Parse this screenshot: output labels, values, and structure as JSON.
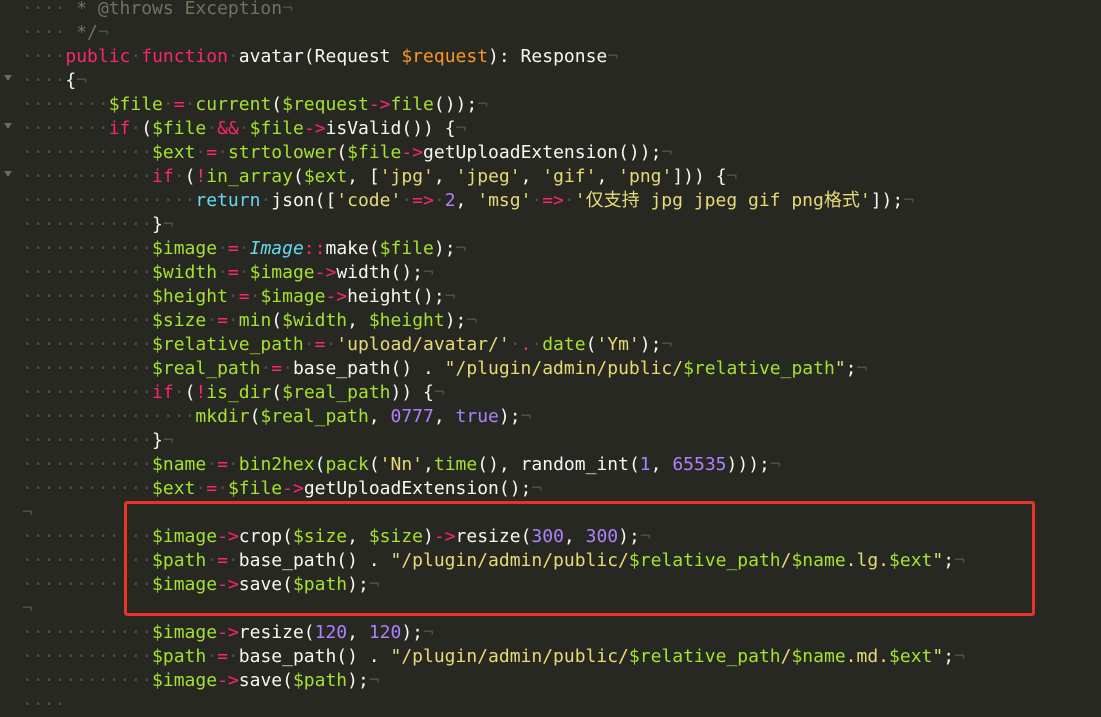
{
  "editor": {
    "lines": [
      [
        [
          "ws",
          "····"
        ],
        [
          "cm",
          " * @throws Exception"
        ],
        [
          "nl",
          "¬"
        ]
      ],
      [
        [
          "ws",
          "····"
        ],
        [
          "cm",
          " */"
        ],
        [
          "nl",
          "¬"
        ]
      ],
      [
        [
          "ws",
          "····"
        ],
        [
          "kw",
          "public"
        ],
        [
          "ws",
          "·"
        ],
        [
          "kw",
          "function"
        ],
        [
          "ws",
          "·"
        ],
        [
          "pl",
          "avatar(Request "
        ],
        [
          "vr",
          "$request"
        ],
        [
          "pl",
          "): Response"
        ],
        [
          "nl",
          "¬"
        ]
      ],
      [
        [
          "ws",
          "····"
        ],
        [
          "pl",
          "{"
        ],
        [
          "nl",
          "¬"
        ]
      ],
      [
        [
          "ws",
          "········"
        ],
        [
          "vb",
          "$file"
        ],
        [
          "ws",
          "·"
        ],
        [
          "op",
          "="
        ],
        [
          "ws",
          "·"
        ],
        [
          "fn",
          "current"
        ],
        [
          "pl",
          "("
        ],
        [
          "vb",
          "$request"
        ],
        [
          "op",
          "->"
        ],
        [
          "fn",
          "file"
        ],
        [
          "pl",
          "());"
        ],
        [
          "nl",
          "¬"
        ]
      ],
      [
        [
          "ws",
          "········"
        ],
        [
          "kw",
          "if"
        ],
        [
          "ws",
          "·"
        ],
        [
          "pl",
          "("
        ],
        [
          "vb",
          "$file"
        ],
        [
          "ws",
          "·"
        ],
        [
          "op",
          "&&"
        ],
        [
          "ws",
          "·"
        ],
        [
          "vb",
          "$file"
        ],
        [
          "op",
          "->"
        ],
        [
          "pl",
          "isValid()) {"
        ],
        [
          "nl",
          "¬"
        ]
      ],
      [
        [
          "ws",
          "············"
        ],
        [
          "vb",
          "$ext"
        ],
        [
          "ws",
          "·"
        ],
        [
          "op",
          "="
        ],
        [
          "ws",
          "·"
        ],
        [
          "fn",
          "strtolower"
        ],
        [
          "pl",
          "("
        ],
        [
          "vb",
          "$file"
        ],
        [
          "op",
          "->"
        ],
        [
          "pl",
          "getUploadExtension());"
        ],
        [
          "nl",
          "¬"
        ]
      ],
      [
        [
          "ws",
          "············"
        ],
        [
          "kw",
          "if"
        ],
        [
          "ws",
          "·"
        ],
        [
          "pl",
          "("
        ],
        [
          "op",
          "!"
        ],
        [
          "fn",
          "in_array"
        ],
        [
          "pl",
          "("
        ],
        [
          "vb",
          "$ext"
        ],
        [
          "pl",
          ", ["
        ],
        [
          "str",
          "'jpg'"
        ],
        [
          "pl",
          ", "
        ],
        [
          "str",
          "'jpeg'"
        ],
        [
          "pl",
          ", "
        ],
        [
          "str",
          "'gif'"
        ],
        [
          "pl",
          ", "
        ],
        [
          "str",
          "'png'"
        ],
        [
          "pl",
          "])) {"
        ],
        [
          "nl",
          "¬"
        ]
      ],
      [
        [
          "ws",
          "················"
        ],
        [
          "st",
          "return"
        ],
        [
          "ws",
          "·"
        ],
        [
          "pl",
          "json(["
        ],
        [
          "str",
          "'code'"
        ],
        [
          "ws",
          "·"
        ],
        [
          "op",
          "=>"
        ],
        [
          "ws",
          "·"
        ],
        [
          "num",
          "2"
        ],
        [
          "pl",
          ", "
        ],
        [
          "str",
          "'msg'"
        ],
        [
          "ws",
          "·"
        ],
        [
          "op",
          "=>"
        ],
        [
          "ws",
          "·"
        ],
        [
          "str",
          "'仅支持 jpg jpeg gif png格式'"
        ],
        [
          "pl",
          "]);"
        ],
        [
          "nl",
          "¬"
        ]
      ],
      [
        [
          "ws",
          "············"
        ],
        [
          "pl",
          "}"
        ],
        [
          "nl",
          "¬"
        ]
      ],
      [
        [
          "ws",
          "············"
        ],
        [
          "vb",
          "$image"
        ],
        [
          "ws",
          "·"
        ],
        [
          "op",
          "="
        ],
        [
          "ws",
          "·"
        ],
        [
          "cls",
          "Image"
        ],
        [
          "op",
          "::"
        ],
        [
          "pl",
          "make("
        ],
        [
          "vb",
          "$file"
        ],
        [
          "pl",
          ");"
        ],
        [
          "nl",
          "¬"
        ]
      ],
      [
        [
          "ws",
          "············"
        ],
        [
          "vb",
          "$width"
        ],
        [
          "ws",
          "·"
        ],
        [
          "op",
          "="
        ],
        [
          "ws",
          "·"
        ],
        [
          "vb",
          "$image"
        ],
        [
          "op",
          "->"
        ],
        [
          "pl",
          "width();"
        ],
        [
          "nl",
          "¬"
        ]
      ],
      [
        [
          "ws",
          "············"
        ],
        [
          "vb",
          "$height"
        ],
        [
          "ws",
          "·"
        ],
        [
          "op",
          "="
        ],
        [
          "ws",
          "·"
        ],
        [
          "vb",
          "$image"
        ],
        [
          "op",
          "->"
        ],
        [
          "pl",
          "height();"
        ],
        [
          "nl",
          "¬"
        ]
      ],
      [
        [
          "ws",
          "············"
        ],
        [
          "vb",
          "$size"
        ],
        [
          "ws",
          "·"
        ],
        [
          "op",
          "="
        ],
        [
          "ws",
          "·"
        ],
        [
          "fn",
          "min"
        ],
        [
          "pl",
          "("
        ],
        [
          "vb",
          "$width"
        ],
        [
          "pl",
          ", "
        ],
        [
          "vb",
          "$height"
        ],
        [
          "pl",
          ");"
        ],
        [
          "nl",
          "¬"
        ]
      ],
      [
        [
          "ws",
          "············"
        ],
        [
          "vb",
          "$relative_path"
        ],
        [
          "ws",
          "·"
        ],
        [
          "op",
          "="
        ],
        [
          "ws",
          "·"
        ],
        [
          "str",
          "'upload/avatar/'"
        ],
        [
          "ws",
          "·"
        ],
        [
          "op",
          "."
        ],
        [
          "ws",
          "·"
        ],
        [
          "fn",
          "date"
        ],
        [
          "pl",
          "("
        ],
        [
          "str",
          "'Ym'"
        ],
        [
          "pl",
          ");"
        ],
        [
          "nl",
          "¬"
        ]
      ],
      [
        [
          "ws",
          "············"
        ],
        [
          "vb",
          "$real_path"
        ],
        [
          "ws",
          "·"
        ],
        [
          "op",
          "="
        ],
        [
          "ws",
          "·"
        ],
        [
          "pl",
          "base_path() . "
        ],
        [
          "str",
          "\"/plugin/admin/public/"
        ],
        [
          "vb",
          "$relative_path"
        ],
        [
          "str",
          "\""
        ],
        [
          "pl",
          ";"
        ],
        [
          "nl",
          "¬"
        ]
      ],
      [
        [
          "ws",
          "············"
        ],
        [
          "kw",
          "if"
        ],
        [
          "ws",
          "·"
        ],
        [
          "pl",
          "("
        ],
        [
          "op",
          "!"
        ],
        [
          "fn",
          "is_dir"
        ],
        [
          "pl",
          "("
        ],
        [
          "vb",
          "$real_path"
        ],
        [
          "pl",
          ")) {"
        ],
        [
          "nl",
          "¬"
        ]
      ],
      [
        [
          "ws",
          "················"
        ],
        [
          "fn",
          "mkdir"
        ],
        [
          "pl",
          "("
        ],
        [
          "vb",
          "$real_path"
        ],
        [
          "pl",
          ", "
        ],
        [
          "num",
          "0777"
        ],
        [
          "pl",
          ", "
        ],
        [
          "num",
          "true"
        ],
        [
          "pl",
          ");"
        ],
        [
          "nl",
          "¬"
        ]
      ],
      [
        [
          "ws",
          "············"
        ],
        [
          "pl",
          "}"
        ],
        [
          "nl",
          "¬"
        ]
      ],
      [
        [
          "ws",
          "············"
        ],
        [
          "vb",
          "$name"
        ],
        [
          "ws",
          "·"
        ],
        [
          "op",
          "="
        ],
        [
          "ws",
          "·"
        ],
        [
          "fn",
          "bin2hex"
        ],
        [
          "pl",
          "("
        ],
        [
          "fn",
          "pack"
        ],
        [
          "pl",
          "("
        ],
        [
          "str",
          "'Nn'"
        ],
        [
          "pl",
          ","
        ],
        [
          "fn",
          "time"
        ],
        [
          "pl",
          "(), random_int("
        ],
        [
          "num",
          "1"
        ],
        [
          "pl",
          ", "
        ],
        [
          "num",
          "65535"
        ],
        [
          "pl",
          ")));"
        ],
        [
          "nl",
          "¬"
        ]
      ],
      [
        [
          "ws",
          "············"
        ],
        [
          "vb",
          "$ext"
        ],
        [
          "ws",
          "·"
        ],
        [
          "op",
          "="
        ],
        [
          "ws",
          "·"
        ],
        [
          "vb",
          "$file"
        ],
        [
          "op",
          "->"
        ],
        [
          "pl",
          "getUploadExtension();"
        ],
        [
          "nl",
          "¬"
        ]
      ],
      [
        [
          "nl",
          "¬"
        ]
      ],
      [
        [
          "ws",
          "············"
        ],
        [
          "vb",
          "$image"
        ],
        [
          "op",
          "->"
        ],
        [
          "pl",
          "crop("
        ],
        [
          "vb",
          "$size"
        ],
        [
          "pl",
          ", "
        ],
        [
          "vb",
          "$size"
        ],
        [
          "pl",
          ")"
        ],
        [
          "op",
          "->"
        ],
        [
          "pl",
          "resize("
        ],
        [
          "num",
          "300"
        ],
        [
          "pl",
          ", "
        ],
        [
          "num",
          "300"
        ],
        [
          "pl",
          ");"
        ],
        [
          "nl",
          "¬"
        ]
      ],
      [
        [
          "ws",
          "············"
        ],
        [
          "vb",
          "$path"
        ],
        [
          "ws",
          "·"
        ],
        [
          "op",
          "="
        ],
        [
          "ws",
          "·"
        ],
        [
          "pl",
          "base_path() . "
        ],
        [
          "str",
          "\"/plugin/admin/public/"
        ],
        [
          "vb",
          "$relative_path"
        ],
        [
          "str",
          "/"
        ],
        [
          "vb",
          "$name"
        ],
        [
          "str",
          ".lg."
        ],
        [
          "vb",
          "$ext"
        ],
        [
          "str",
          "\""
        ],
        [
          "pl",
          ";"
        ],
        [
          "nl",
          "¬"
        ]
      ],
      [
        [
          "ws",
          "············"
        ],
        [
          "vb",
          "$image"
        ],
        [
          "op",
          "->"
        ],
        [
          "pl",
          "save("
        ],
        [
          "vb",
          "$path"
        ],
        [
          "pl",
          ");"
        ],
        [
          "nl",
          "¬"
        ]
      ],
      [
        [
          "nl",
          "¬"
        ]
      ],
      [
        [
          "ws",
          "············"
        ],
        [
          "vb",
          "$image"
        ],
        [
          "op",
          "->"
        ],
        [
          "pl",
          "resize("
        ],
        [
          "num",
          "120"
        ],
        [
          "pl",
          ", "
        ],
        [
          "num",
          "120"
        ],
        [
          "pl",
          ");"
        ],
        [
          "nl",
          "¬"
        ]
      ],
      [
        [
          "ws",
          "············"
        ],
        [
          "vb",
          "$path"
        ],
        [
          "ws",
          "·"
        ],
        [
          "op",
          "="
        ],
        [
          "ws",
          "·"
        ],
        [
          "pl",
          "base_path() . "
        ],
        [
          "str",
          "\"/plugin/admin/public/"
        ],
        [
          "vb",
          "$relative_path"
        ],
        [
          "str",
          "/"
        ],
        [
          "vb",
          "$name"
        ],
        [
          "str",
          ".md."
        ],
        [
          "vb",
          "$ext"
        ],
        [
          "str",
          "\""
        ],
        [
          "pl",
          ";"
        ],
        [
          "nl",
          "¬"
        ]
      ],
      [
        [
          "ws",
          "············"
        ],
        [
          "vb",
          "$image"
        ],
        [
          "op",
          "->"
        ],
        [
          "pl",
          "save("
        ],
        [
          "vb",
          "$path"
        ],
        [
          "pl",
          ");"
        ],
        [
          "nl",
          "¬"
        ]
      ],
      [
        [
          "ws",
          "····"
        ]
      ]
    ],
    "fold_rows": [
      3,
      5,
      7
    ]
  },
  "colors": {
    "background": "#272822",
    "highlight_border": "#e8322a"
  }
}
